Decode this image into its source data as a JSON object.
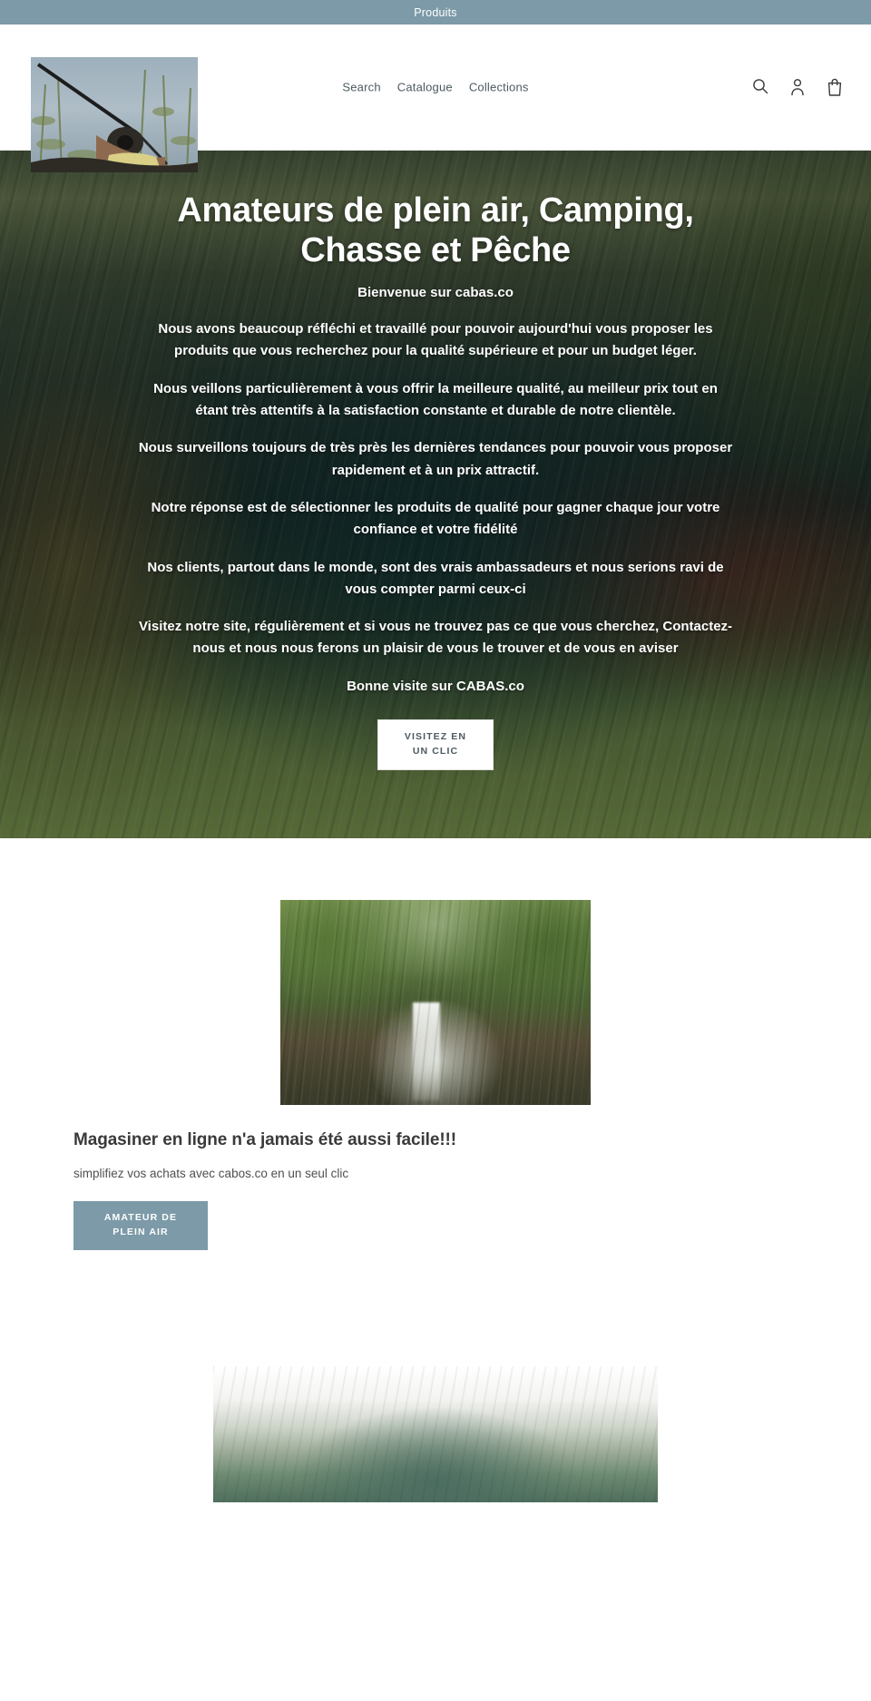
{
  "announcement": {
    "text": "Produits",
    "bg": "#7c9aa8"
  },
  "header": {
    "logo_alt": "cabas.co fishing logo",
    "nav": [
      {
        "label": "Search",
        "name": "search"
      },
      {
        "label": "Catalogue",
        "name": "catalogue"
      },
      {
        "label": "Collections",
        "name": "collections"
      }
    ],
    "icons": [
      {
        "name": "search-icon",
        "label": "Search"
      },
      {
        "name": "account-icon",
        "label": "Log in"
      },
      {
        "name": "cart-icon",
        "label": "Cart"
      }
    ]
  },
  "hero": {
    "title": "Amateurs de plein air, Camping, Chasse et Pêche",
    "subtitle": "Bienvenue sur cabas.co",
    "paragraphs": [
      "Nous avons beaucoup réfléchi et travaillé pour pouvoir aujourd'hui vous proposer les produits que vous recherchez pour la qualité supérieure et pour un budget léger.",
      "Nous veillons particulièrement à vous offrir la meilleure qualité, au meilleur prix tout en étant très attentifs à la satisfaction constante et durable de notre clientèle.",
      "Nous surveillons toujours de très près les dernières tendances pour pouvoir vous proposer rapidement et à un prix attractif.",
      "Notre réponse est de sélectionner les produits de qualité pour gagner chaque jour votre confiance et votre fidélité",
      "Nos clients, partout dans le monde, sont des vrais ambassadeurs et nous serions ravi de vous compter parmi ceux-ci",
      "Visitez notre site, régulièrement   et si vous ne trouvez pas ce que vous cherchez, Contactez-nous et nous nous ferons un plaisir de vous le trouver et de vous en aviser",
      "Bonne visite sur CABAS.co"
    ],
    "cta_label": "VISITEZ EN UN CLIC"
  },
  "feature": {
    "image_alt": "Waterfall in the forest",
    "title": "Magasiner en ligne n'a jamais été aussi facile!!!",
    "body": "simplifiez vos achats  avec cabos.co en un seul clic",
    "button_label": "AMATEUR DE PLEIN AIR",
    "button_color": "#7c9aa8"
  },
  "bottom": {
    "image_alt": "Camping tent"
  }
}
